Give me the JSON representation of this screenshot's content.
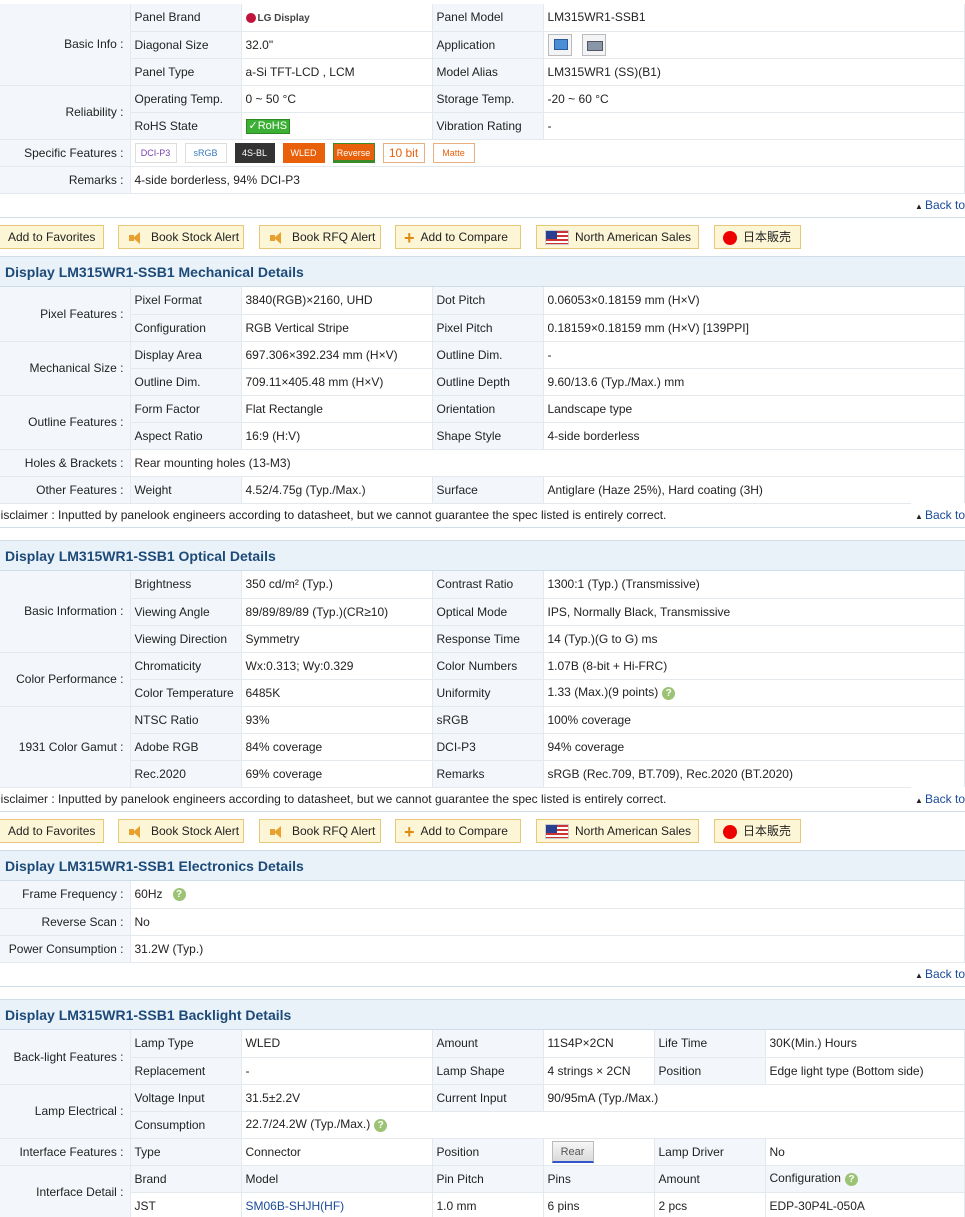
{
  "nav": {
    "back_to": "Back to"
  },
  "basic": {
    "sec_basic": "Basic Info :",
    "sec_reliability": "Reliability :",
    "sec_features": "Specific Features :",
    "sec_remarks": "Remarks :",
    "panel_brand_l": "Panel Brand",
    "panel_brand_v": "LG Display",
    "panel_model_l": "Panel Model",
    "panel_model_v": "LM315WR1-SSB1",
    "diag_l": "Diagonal Size",
    "diag_v": "32.0\"",
    "app_l": "Application",
    "type_l": "Panel Type",
    "type_v": "a-Si TFT-LCD , LCM",
    "alias_l": "Model Alias",
    "alias_v": "LM315WR1 (SS)(B1)",
    "op_l": "Operating Temp.",
    "op_v": "0 ~ 50 °C",
    "st_l": "Storage Temp.",
    "st_v": "-20 ~ 60 °C",
    "rohs_l": "RoHS State",
    "rohs_v": "RoHS",
    "vib_l": "Vibration Rating",
    "vib_v": "-",
    "badges": [
      "DCI-P3",
      "sRGB",
      "4S-BL",
      "WLED",
      "Reverse",
      "10 bit",
      "Matte"
    ],
    "remarks_v": "4-side borderless, 94% DCI-P3"
  },
  "buttons": {
    "fav": "Add to Favorites",
    "stock": "Book Stock Alert",
    "rfq": "Book RFQ Alert",
    "compare": "Add to Compare",
    "na": "North American Sales",
    "jp": "日本販売"
  },
  "mech": {
    "title": "Display LM315WR1-SSB1 Mechanical Details",
    "sec_pixel": "Pixel Features :",
    "sec_size": "Mechanical Size :",
    "sec_outline": "Outline Features :",
    "sec_holes": "Holes & Brackets :",
    "sec_other": "Other Features :",
    "pf_l": "Pixel Format",
    "pf_v": "3840(RGB)×2160, UHD",
    "dp_l": "Dot Pitch",
    "dp_v": "0.06053×0.18159 mm (H×V)",
    "cfg_l": "Configuration",
    "cfg_v": "RGB Vertical Stripe",
    "pp_l": "Pixel Pitch",
    "pp_v": "0.18159×0.18159 mm (H×V)  [139PPI]",
    "da_l": "Display Area",
    "da_v": "697.306×392.234 mm (H×V)",
    "od1_l": "Outline Dim.",
    "od1_v": "-",
    "od2_l": "Outline Dim.",
    "od2_v": "709.11×405.48 mm (H×V)",
    "odp_l": "Outline Depth",
    "odp_v": "9.60/13.6 (Typ./Max.) mm",
    "ff_l": "Form Factor",
    "ff_v": "Flat Rectangle",
    "or_l": "Orientation",
    "or_v": "Landscape type",
    "ar_l": "Aspect Ratio",
    "ar_v": "16:9 (H:V)",
    "ss_l": "Shape Style",
    "ss_v": "4-side borderless",
    "holes_v": "Rear mounting holes (13-M3)",
    "wt_l": "Weight",
    "wt_v": "4.52/4.75g (Typ./Max.)",
    "sf_l": "Surface",
    "sf_v": "Antiglare (Haze 25%), Hard coating (3H)"
  },
  "disclaimer": "Disclaimer : Inputted by panelook engineers according to datasheet, but we cannot guarantee the spec listed is entirely correct.",
  "opt": {
    "title": "Display LM315WR1-SSB1 Optical Details",
    "sec_basic": "Basic Information :",
    "sec_color": "Color Performance :",
    "sec_gamut": "1931 Color Gamut :",
    "br_l": "Brightness",
    "br_v": "350 cd/m² (Typ.)",
    "cr_l": "Contrast Ratio",
    "cr_v": "1300:1 (Typ.) (Transmissive)",
    "va_l": "Viewing Angle",
    "va_v": "89/89/89/89 (Typ.)(CR≥10)",
    "om_l": "Optical Mode",
    "om_v": "IPS, Normally Black, Transmissive",
    "vd_l": "Viewing Direction",
    "vd_v": "Symmetry",
    "rt_l": "Response Time",
    "rt_v": "14 (Typ.)(G to G) ms",
    "ch_l": "Chromaticity",
    "ch_v": "Wx:0.313; Wy:0.329",
    "cn_l": "Color Numbers",
    "cn_v": "1.07B (8-bit + Hi-FRC)",
    "ct_l": "Color Temperature",
    "ct_v": "6485K",
    "un_l": "Uniformity",
    "un_v": "1.33 (Max.)(9 points)",
    "nt_l": "NTSC Ratio",
    "nt_v": "93%",
    "srgb_l": "sRGB",
    "srgb_v": "100% coverage",
    "ad_l": "Adobe RGB",
    "ad_v": "84% coverage",
    "dci_l": "DCI-P3",
    "dci_v": "94% coverage",
    "rec_l": "Rec.2020",
    "rec_v": "69% coverage",
    "rm_l": "Remarks",
    "rm_v": "sRGB (Rec.709, BT.709), Rec.2020 (BT.2020)"
  },
  "elec": {
    "title": "Display LM315WR1-SSB1 Electronics Details",
    "ff_l": "Frame Frequency :",
    "ff_v": "60Hz",
    "rs_l": "Reverse Scan :",
    "rs_v": "No",
    "pc_l": "Power Consumption :",
    "pc_v": "31.2W (Typ.)"
  },
  "bl": {
    "title": "Display LM315WR1-SSB1 Backlight Details",
    "sec_feat": "Back-light Features :",
    "sec_elec": "Lamp Electrical :",
    "sec_if": "Interface Features :",
    "sec_detail": "Interface Detail :",
    "lt_l": "Lamp Type",
    "lt_v": "WLED",
    "am_l": "Amount",
    "am_v": "11S4P×2CN",
    "life_l": "Life Time",
    "life_v": "30K(Min.) Hours",
    "rp_l": "Replacement",
    "rp_v": "-",
    "ls_l": "Lamp Shape",
    "ls_v": "4 strings × 2CN",
    "pos_l": "Position",
    "pos_v": "Edge light type (Bottom side)",
    "vi_l": "Voltage Input",
    "vi_v": "31.5±2.2V",
    "ci_l": "Current Input",
    "ci_v": "90/95mA (Typ./Max.)",
    "cs_l": "Consumption",
    "cs_v": "22.7/24.2W (Typ./Max.)",
    "ty_l": "Type",
    "ty_v": "Connector",
    "ip_l": "Position",
    "ip_v": "Rear",
    "ld_l": "Lamp Driver",
    "ld_v": "No",
    "h_brand": "Brand",
    "h_model": "Model",
    "h_pitch": "Pin Pitch",
    "h_pins": "Pins",
    "h_amount": "Amount",
    "h_cfg": "Configuration",
    "d_brand": "JST",
    "d_model": "SM06B-SHJH(HF)",
    "d_pitch": "1.0 mm",
    "d_pins": "6 pins",
    "d_amount": "2 pcs",
    "d_cfg": "EDP-30P4L-050A"
  }
}
